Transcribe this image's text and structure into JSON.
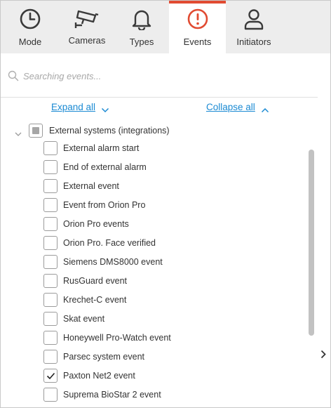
{
  "tabs": [
    {
      "label": "Mode",
      "icon": "clock-icon",
      "active": false
    },
    {
      "label": "Cameras",
      "icon": "camera-icon",
      "active": false
    },
    {
      "label": "Types",
      "icon": "bell-icon",
      "active": false
    },
    {
      "label": "Events",
      "icon": "alert-circle-icon",
      "active": true
    },
    {
      "label": "Initiators",
      "icon": "user-icon",
      "active": false
    }
  ],
  "search": {
    "placeholder": "Searching events..."
  },
  "controls": {
    "expand_all": "Expand all",
    "collapse_all": "Collapse all"
  },
  "group": {
    "label": "External systems (integrations)",
    "state": "partial",
    "items": [
      {
        "label": "External alarm start",
        "checked": false
      },
      {
        "label": "End of external alarm",
        "checked": false
      },
      {
        "label": "External event",
        "checked": false
      },
      {
        "label": "Event from Orion Pro",
        "checked": false
      },
      {
        "label": "Orion Pro events",
        "checked": false
      },
      {
        "label": "Orion Pro. Face verified",
        "checked": false
      },
      {
        "label": "Siemens DMS8000 event",
        "checked": false
      },
      {
        "label": "RusGuard event",
        "checked": false
      },
      {
        "label": "Krechet-C event",
        "checked": false
      },
      {
        "label": "Skat event",
        "checked": false
      },
      {
        "label": "Honeywell Pro-Watch event",
        "checked": false
      },
      {
        "label": "Parsec system event",
        "checked": false
      },
      {
        "label": "Paxton Net2 event",
        "checked": true
      },
      {
        "label": "Suprema BioStar 2 event",
        "checked": false
      }
    ]
  },
  "colors": {
    "accent": "#e14b32",
    "link": "#1b8ad3",
    "tabbar_bg": "#ededed"
  }
}
